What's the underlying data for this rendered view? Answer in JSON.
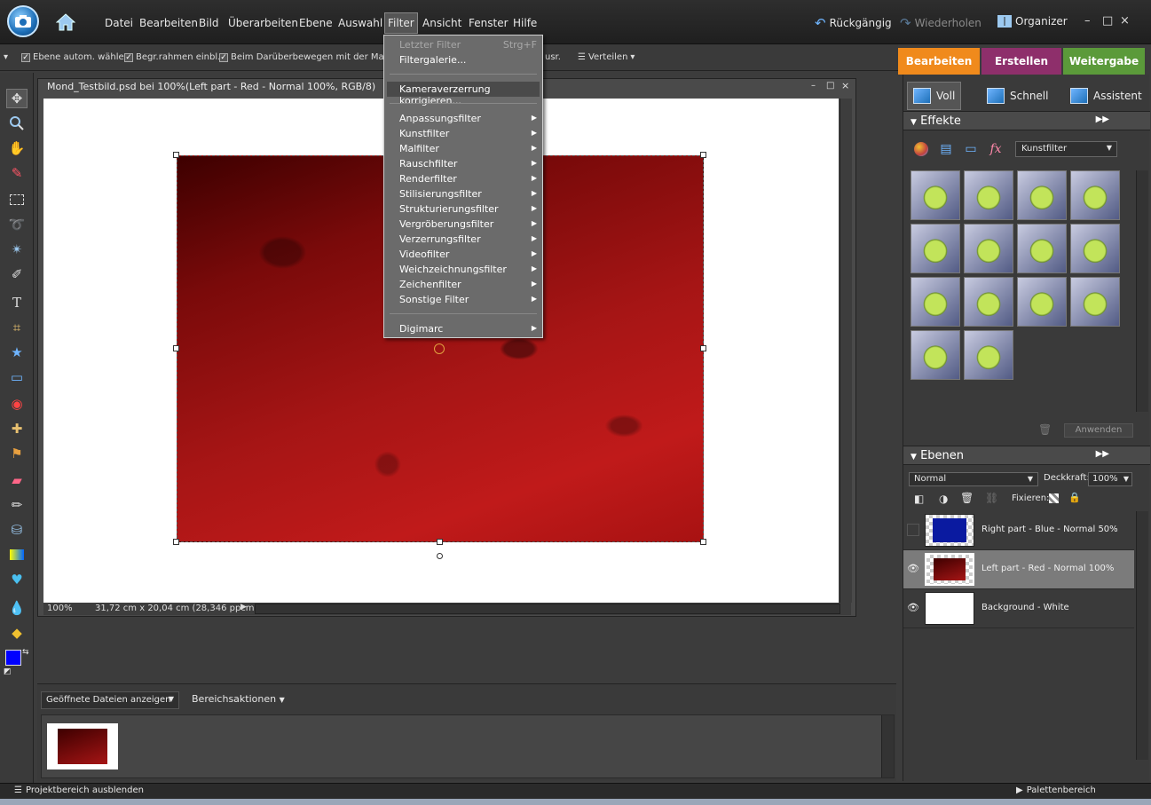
{
  "menubar": {
    "items": [
      "Datei",
      "Bearbeiten",
      "Bild",
      "Überarbeiten",
      "Ebene",
      "Auswahl",
      "Filter",
      "Ansicht",
      "Fenster",
      "Hilfe"
    ],
    "undo_label": "Rückgängig",
    "redo_label": "Wiederholen",
    "organizer_label": "Organizer",
    "minimize": "–",
    "maximize": "□",
    "close": "×"
  },
  "options": {
    "auto_select": "Ebene autom. wählen",
    "bounding_box": "Begr.rahmen einbl.",
    "hover": "Beim Darüberbewegen mit der Maus he",
    "align_cut": "usr.",
    "distribute": "Verteilen"
  },
  "mode_tabs": [
    {
      "label": "Bearbeiten",
      "color": "#f08a1c"
    },
    {
      "label": "Erstellen",
      "color": "#8e2f6b"
    },
    {
      "label": "Weitergabe",
      "color": "#5b9a3a"
    }
  ],
  "edit_modes": [
    "Voll",
    "Schnell",
    "Assistent"
  ],
  "document": {
    "title": "Mond_Testbild.psd bei 100%(Left part - Red - Normal 100%, RGB/8)",
    "zoom": "100%",
    "dimensions": "31,72 cm x 20,04 cm (28,346 ppcm)"
  },
  "filter_menu": {
    "last_filter": "Letzter Filter",
    "last_filter_shortcut": "Strg+F",
    "gallery": "Filtergalerie...",
    "camera_distortion": "Kameraverzerrung korrigieren...",
    "submenus": [
      "Anpassungsfilter",
      "Kunstfilter",
      "Malfilter",
      "Rauschfilter",
      "Renderfilter",
      "Stilisierungsfilter",
      "Strukturierungsfilter",
      "Vergröberungsfilter",
      "Verzerrungsfilter",
      "Videofilter",
      "Weichzeichnungsfilter",
      "Zeichenfilter",
      "Sonstige Filter"
    ],
    "digimarc": "Digimarc"
  },
  "effects": {
    "title": "Effekte",
    "category": "Kunstfilter",
    "apply": "Anwenden",
    "thumb_count": 14
  },
  "layers": {
    "title": "Ebenen",
    "blend_mode": "Normal",
    "opacity_label": "Deckkraft:",
    "opacity_value": "100%",
    "lock_label": "Fixieren:",
    "items": [
      {
        "name": "Right part - Blue - Normal 50%",
        "visible": false,
        "selected": false,
        "fill": "#0a1aa0"
      },
      {
        "name": "Left part - Red - Normal 100%",
        "visible": true,
        "selected": true,
        "fill": "#8a0c0c"
      },
      {
        "name": "Background - White",
        "visible": true,
        "selected": false,
        "fill": "#ffffff"
      }
    ]
  },
  "project_bin": {
    "dropdown": "Geöffnete Dateien anzeigen",
    "actions": "Bereichsaktionen"
  },
  "bottom": {
    "hide_project": "Projektbereich ausblenden",
    "palette": "Palettenbereich"
  },
  "colors": {
    "foreground": "#0000ff",
    "background": "#ffffff"
  }
}
